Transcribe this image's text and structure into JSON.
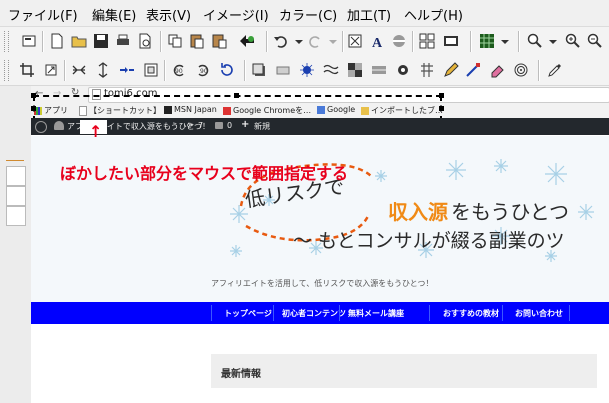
{
  "menubar": {
    "items": [
      "ファイル(F)",
      "編集(E)",
      "表示(V)",
      "イメージ(I)",
      "カラー(C)",
      "加工(T)",
      "ヘルプ(H)"
    ]
  },
  "browser": {
    "url": "tomi6.com",
    "bookmarks": [
      "アプリ",
      "【ショートカット】",
      "MSN Japan",
      "Google Chromeを…",
      "Google",
      "インポートしたブ…"
    ]
  },
  "wpbar": {
    "site": "アフィリエイトで収入源をもうひとつ！",
    "count": "7",
    "comments": "0",
    "new": "新規"
  },
  "annotation": {
    "arrow": "↑",
    "text": "ぼかしたい部分をマウスで範囲指定する"
  },
  "hero": {
    "line1_a": "低リスクで",
    "line1_b": "収入源",
    "line1_c": "をもうひとつ",
    "line2": "〜 もとコンサルが綴る副業のツ",
    "tagline": "アフィリエイトを活用して、低リスクで収入源をもうひとつ！"
  },
  "nav": {
    "items": [
      "トップページ",
      "初心者コンテンツ",
      "無料メール講座",
      "おすすめの教材",
      "お問い合わせ"
    ]
  },
  "news": {
    "title": "最新情報"
  },
  "colors": {
    "annotation": "#e8001c",
    "nav": "#0000ff",
    "accent_orange": "#f08a16"
  }
}
